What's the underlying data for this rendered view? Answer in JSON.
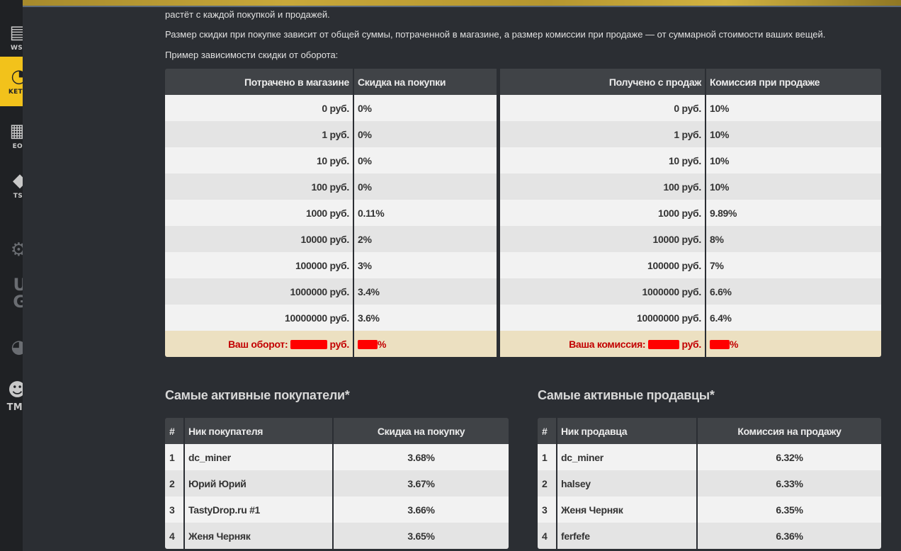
{
  "sidebar": {
    "items": [
      {
        "label": "WS",
        "icon": "news-icon"
      },
      {
        "label": "KET",
        "icon": "market-icon"
      },
      {
        "label": "EO",
        "icon": "video-icon"
      },
      {
        "label": "TS",
        "icon": "bets-icon"
      },
      {
        "label": "",
        "icon": "csgo-logo"
      },
      {
        "label": "U G",
        "icon": "pubg-logo"
      },
      {
        "label": "",
        "icon": "gamepad-icon"
      },
      {
        "label": "TM",
        "icon": "tm-mascot"
      }
    ]
  },
  "intro": {
    "line1": "растёт с каждой покупкой и продажей.",
    "line2": "Размер скидки при покупке зависит от общей суммы, потраченной в магазине, а размер комиссии при продаже — от суммарной стоимости ваших вещей.",
    "line3": "Пример зависимости скидки от оборота:"
  },
  "discount_table": {
    "headers": [
      "Потрачено в магазине",
      "Скидка на покупки",
      "Получено с продаж",
      "Комиссия при продаже"
    ],
    "rows": [
      [
        "0 руб.",
        "0%",
        "0 руб.",
        "10%"
      ],
      [
        "1 руб.",
        "0%",
        "1 руб.",
        "10%"
      ],
      [
        "10 руб.",
        "0%",
        "10 руб.",
        "10%"
      ],
      [
        "100 руб.",
        "0%",
        "100 руб.",
        "10%"
      ],
      [
        "1000 руб.",
        "0.11%",
        "1000 руб.",
        "9.89%"
      ],
      [
        "10000 руб.",
        "2%",
        "10000 руб.",
        "8%"
      ],
      [
        "100000 руб.",
        "3%",
        "100000 руб.",
        "7%"
      ],
      [
        "1000000 руб.",
        "3.4%",
        "1000000 руб.",
        "6.6%"
      ],
      [
        "10000000 руб.",
        "3.6%",
        "10000000 руб.",
        "6.4%"
      ]
    ],
    "total": {
      "turnover_label": "Ваш оборот:",
      "currency": "руб.",
      "percent_sign": "%",
      "commission_label": "Ваша комиссия:"
    }
  },
  "buyers": {
    "title": "Самые активные покупатели*",
    "headers": [
      "#",
      "Ник покупателя",
      "Скидка на покупку"
    ],
    "rows": [
      [
        "1",
        "dc_miner",
        "3.68%"
      ],
      [
        "2",
        "Юрий Юрий",
        "3.67%"
      ],
      [
        "3",
        "TastyDrop.ru #1",
        "3.66%"
      ],
      [
        "4",
        "Женя Черняк",
        "3.65%"
      ]
    ]
  },
  "sellers": {
    "title": "Самые активные продавцы*",
    "headers": [
      "#",
      "Ник продавца",
      "Комиссия на продажу"
    ],
    "rows": [
      [
        "1",
        "dc_miner",
        "6.32%"
      ],
      [
        "2",
        "halsey",
        "6.33%"
      ],
      [
        "3",
        "Женя Черняк",
        "6.35%"
      ],
      [
        "4",
        "ferfefe",
        "6.36%"
      ]
    ]
  },
  "colors": {
    "background": "#2b2e33",
    "header": "#404347",
    "active_sidebar": "#f2c21b",
    "total_row": "#ece0c1",
    "total_text": "#c20000",
    "redaction": "#ff0000"
  }
}
